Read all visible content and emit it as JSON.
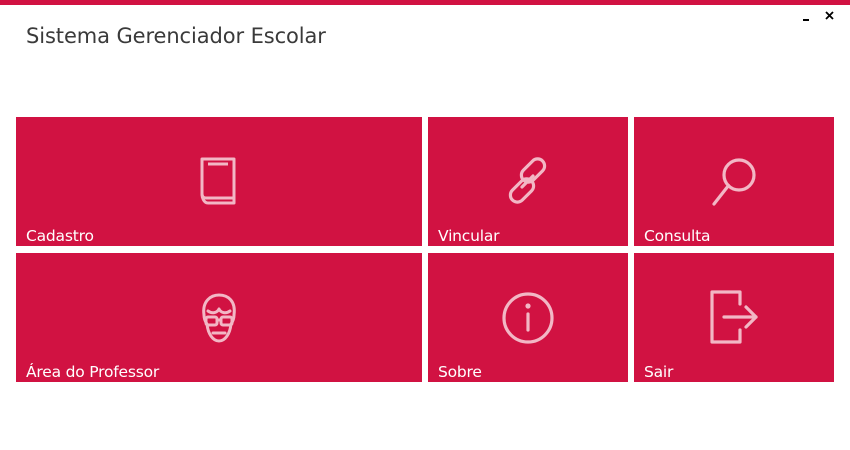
{
  "app": {
    "title": "Sistema Gerenciador Escolar",
    "accent_color": "#d11242",
    "icon_color": "#f2b7c5"
  },
  "window_controls": {
    "minimize": "minimize-icon",
    "close": "close-icon"
  },
  "tiles": [
    {
      "label": "Cadastro",
      "icon": "book-icon"
    },
    {
      "label": "Vincular",
      "icon": "link-icon"
    },
    {
      "label": "Consulta",
      "icon": "search-icon"
    },
    {
      "label": "Área do Professor",
      "icon": "teacher-icon"
    },
    {
      "label": "Sobre",
      "icon": "info-icon"
    },
    {
      "label": "Sair",
      "icon": "exit-icon"
    }
  ]
}
